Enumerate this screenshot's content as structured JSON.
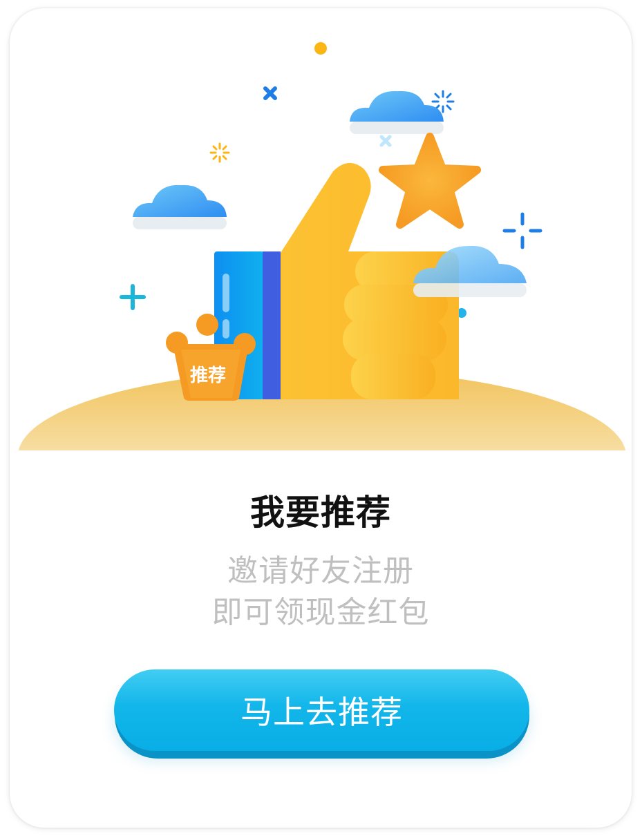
{
  "badge": {
    "label": "推荐"
  },
  "content": {
    "title": "我要推荐",
    "subtitle_line1": "邀请好友注册",
    "subtitle_line2": "即可领现金红包"
  },
  "action": {
    "button_label": "马上去推荐"
  },
  "colors": {
    "button": "#12b6ea",
    "thumb": "#fbbd29",
    "star": "#f7a623",
    "crown": "#f59a22",
    "title": "#111111",
    "subtitle": "#bfbfbf"
  }
}
